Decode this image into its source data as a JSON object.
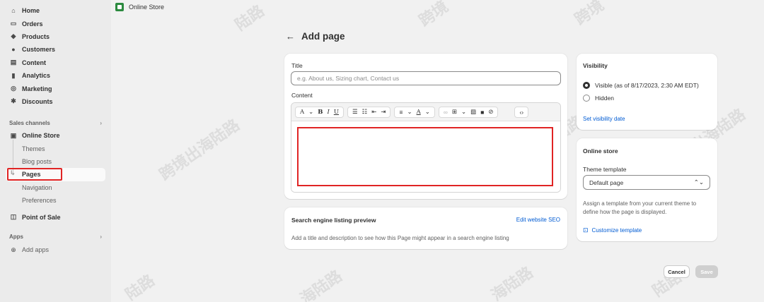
{
  "sidebar": {
    "main_items": [
      {
        "label": "Home",
        "icon": "home-icon"
      },
      {
        "label": "Orders",
        "icon": "orders-icon"
      },
      {
        "label": "Products",
        "icon": "tag-icon"
      },
      {
        "label": "Customers",
        "icon": "person-icon"
      },
      {
        "label": "Content",
        "icon": "content-icon"
      },
      {
        "label": "Analytics",
        "icon": "bar-chart-icon"
      },
      {
        "label": "Marketing",
        "icon": "target-icon"
      },
      {
        "label": "Discounts",
        "icon": "discount-icon"
      }
    ],
    "sales_channels_label": "Sales channels",
    "online_store_label": "Online Store",
    "online_store_sub": [
      "Themes",
      "Blog posts",
      "Pages",
      "Navigation",
      "Preferences"
    ],
    "point_of_sale_label": "Point of Sale",
    "apps_label": "Apps",
    "add_apps_label": "Add apps"
  },
  "topbar": {
    "label": "Online Store"
  },
  "page": {
    "back_label": "←",
    "title": "Add page"
  },
  "main_card": {
    "title_label": "Title",
    "title_placeholder": "e.g. About us, Sizing chart, Contact us",
    "content_label": "Content"
  },
  "seo_card": {
    "title": "Search engine listing preview",
    "edit_link": "Edit website SEO",
    "description": "Add a title and description to see how this Page might appear in a search engine listing"
  },
  "visibility_card": {
    "title": "Visibility",
    "visible_label": "Visible (as of 8/17/2023, 2:30 AM EDT)",
    "hidden_label": "Hidden",
    "set_date_link": "Set visibility date"
  },
  "online_store_card": {
    "title": "Online store",
    "theme_template_label": "Theme template",
    "theme_template_value": "Default page",
    "help_text": "Assign a template from your current theme to define how the page is displayed.",
    "customize_link": "Customize template"
  },
  "actions": {
    "cancel": "Cancel",
    "save": "Save"
  },
  "watermark": "跨境出海陆路",
  "colors": {
    "highlight": "#e02424",
    "link": "#005bd3",
    "brand_green": "#2c8a3f"
  }
}
